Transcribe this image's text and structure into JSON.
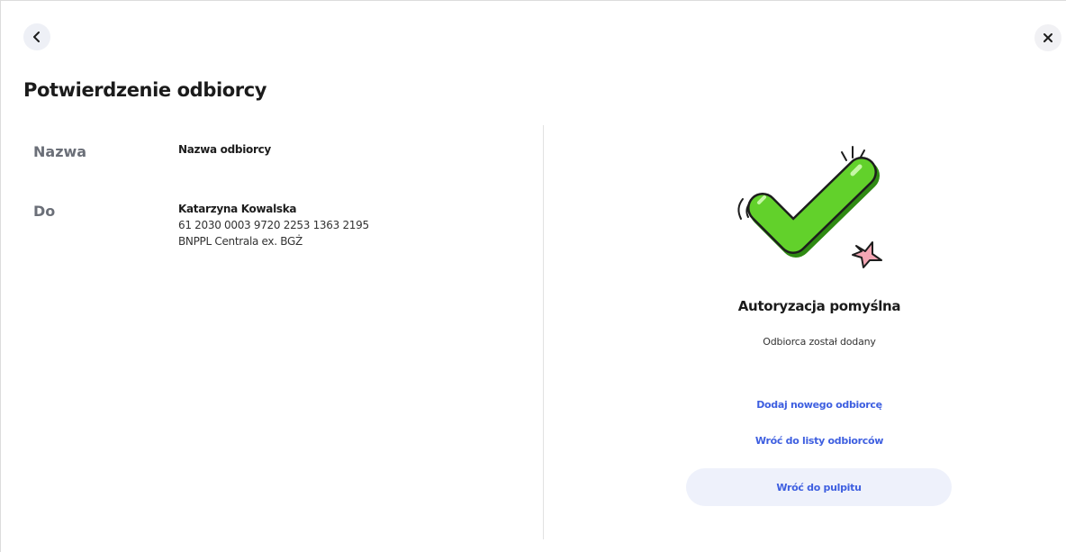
{
  "header": {
    "title": "Potwierdzenie odbiorcy",
    "back_icon": "chevron-left-icon",
    "close_icon": "close-icon"
  },
  "details": {
    "name_label": "Nazwa",
    "name_value": "Nazwa odbiorcy",
    "to_label": "Do",
    "recipient_name": "Katarzyna Kowalska",
    "account_number": "61 2030 0003 9720 2253 1363 2195",
    "bank_name": "BNPPL Centrala ex. BGŻ"
  },
  "result": {
    "illustration_icon": "success-checkmark-icon",
    "title": "Autoryzacja pomyślna",
    "subtitle": "Odbiorca został dodany",
    "link_add": "Dodaj nowego odbiorcę",
    "link_list": "Wróć do listy odbiorców",
    "button_dashboard": "Wróć do pulpitu"
  },
  "colors": {
    "accent": "#3e5fe0",
    "check_green": "#62d12b",
    "button_bg": "#eef1fb"
  }
}
